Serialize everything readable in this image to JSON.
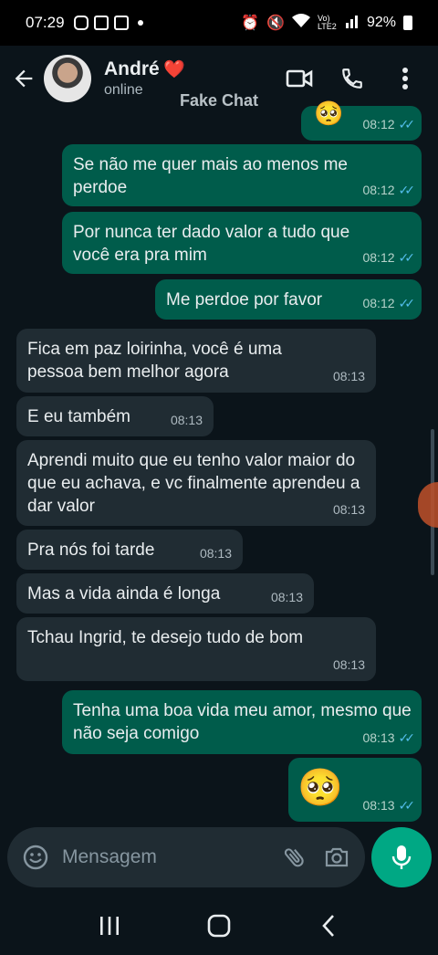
{
  "status_bar": {
    "time": "07:29",
    "battery": "92%",
    "network": "Vo) LTE2"
  },
  "header": {
    "contact_name": "André",
    "heart": "❤️",
    "contact_status": "online"
  },
  "watermark": "Fake Chat",
  "messages": [
    {
      "dir": "out",
      "text": "🥺",
      "time": "08:12",
      "ticks": "✓✓"
    },
    {
      "dir": "out",
      "text": "Se não me quer mais ao menos me perdoe",
      "time": "08:12",
      "ticks": "✓✓"
    },
    {
      "dir": "out",
      "text": "Por nunca ter dado valor a tudo que você era pra mim",
      "time": "08:12",
      "ticks": "✓✓"
    },
    {
      "dir": "out",
      "text": "Me perdoe por favor",
      "time": "08:12",
      "ticks": "✓✓"
    },
    {
      "dir": "in",
      "text": "Fica em paz loirinha, você é uma pessoa bem melhor agora",
      "time": "08:13"
    },
    {
      "dir": "in",
      "text": "E eu também",
      "time": "08:13"
    },
    {
      "dir": "in",
      "text": "Aprendi muito que eu tenho valor maior do que eu achava, e vc finalmente aprendeu a dar valor",
      "time": "08:13"
    },
    {
      "dir": "in",
      "text": "Pra nós foi tarde",
      "time": "08:13"
    },
    {
      "dir": "in",
      "text": "Mas a vida ainda é longa",
      "time": "08:13"
    },
    {
      "dir": "in",
      "text": "Tchau Ingrid, te desejo tudo de bom",
      "time": "08:13"
    },
    {
      "dir": "out",
      "text": "Tenha uma boa vida meu amor, mesmo que não seja comigo",
      "time": "08:13",
      "ticks": "✓✓"
    },
    {
      "dir": "out",
      "text": "🥺",
      "time": "08:13",
      "ticks": "✓✓"
    }
  ],
  "input": {
    "placeholder": "Mensagem"
  },
  "colors": {
    "outgoing": "#005c4b",
    "incoming": "#202c33",
    "accent": "#00a884",
    "read_ticks": "#53bdeb"
  }
}
